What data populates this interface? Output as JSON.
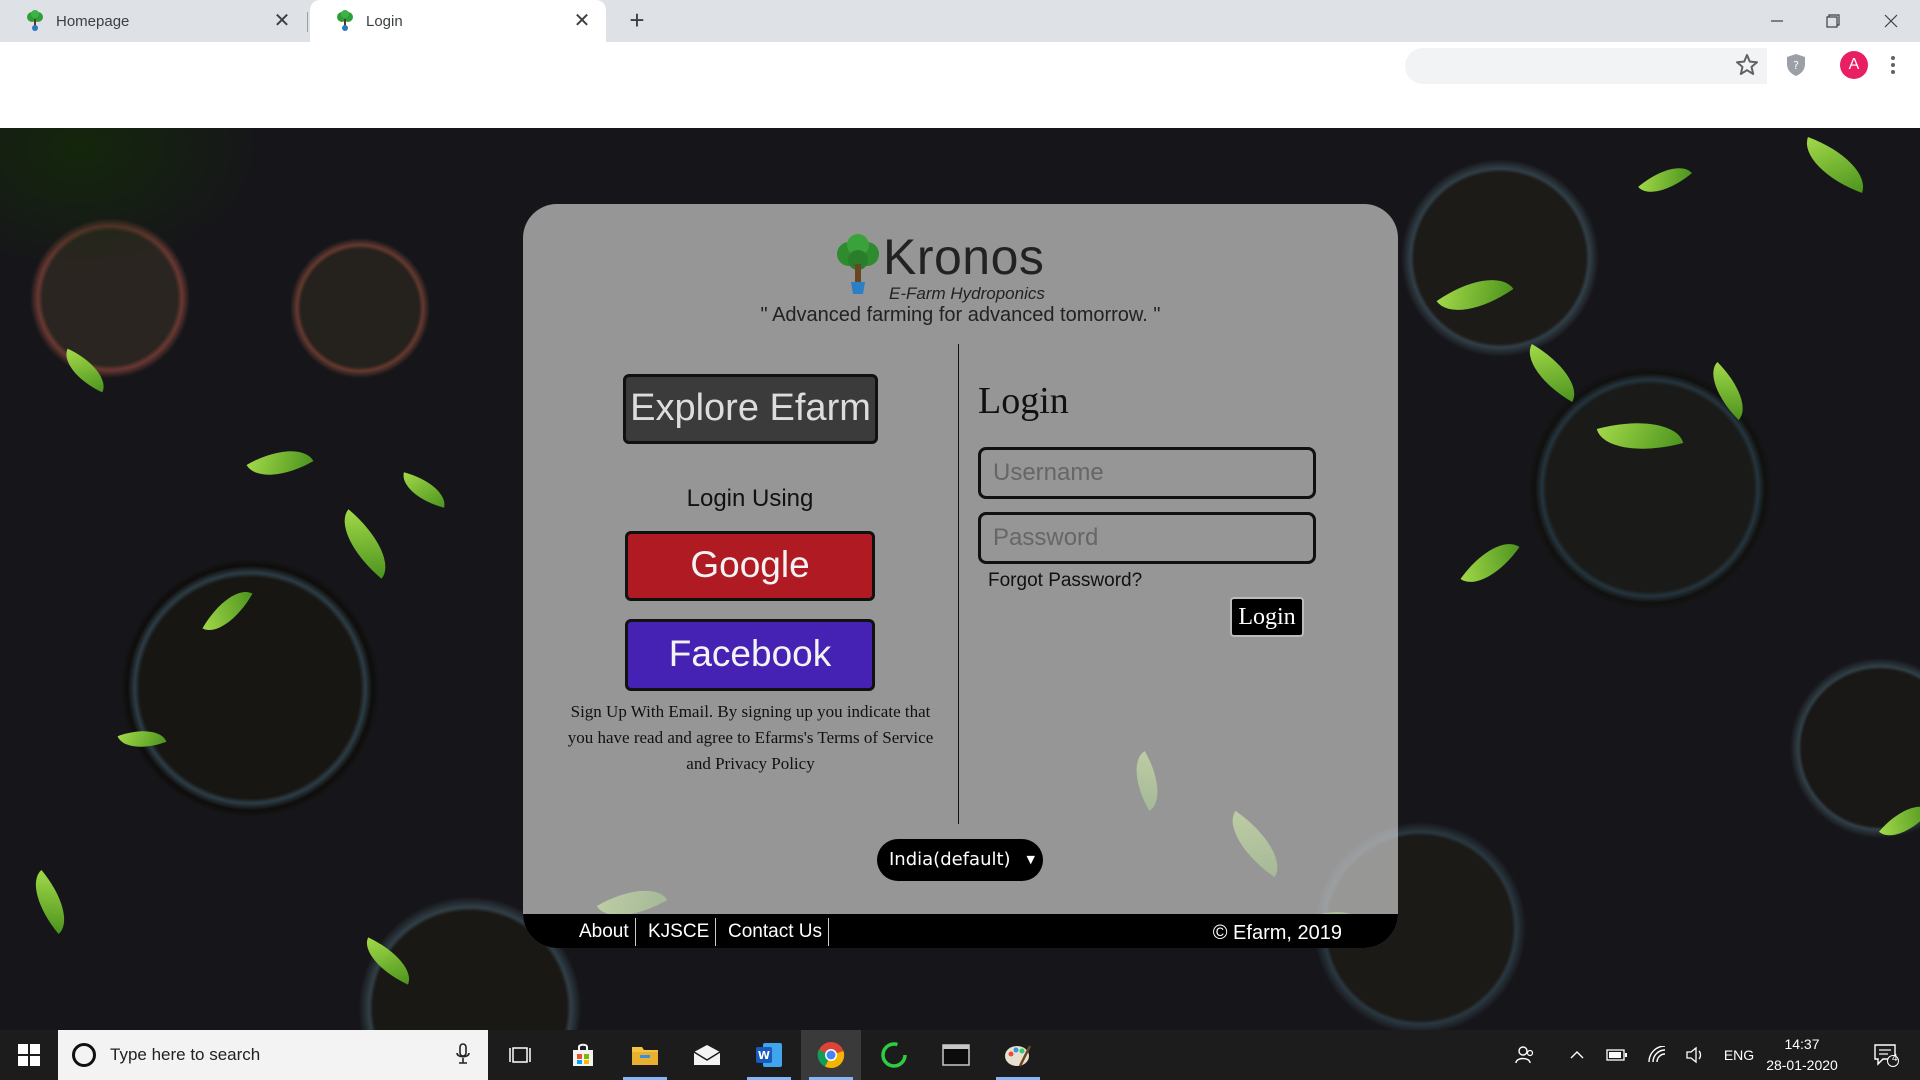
{
  "browser": {
    "tabs": [
      {
        "title": "Homepage",
        "active": false
      },
      {
        "title": "Login",
        "active": true
      }
    ],
    "new_tab": "+",
    "profile_initial": "A"
  },
  "page": {
    "brand": {
      "name": "Kronos",
      "subtitle": "E-Farm Hydroponics"
    },
    "tagline": "\" Advanced farming for advanced tomorrow. \"",
    "explore_button": "Explore Efarm",
    "login_using": "Login Using",
    "google_button": "Google",
    "facebook_button": "Facebook",
    "signup_text": "Sign Up With Email. By signing up you indicate that you have read and agree to Efarms's Terms of Service and Privacy Policy",
    "login": {
      "heading": "Login",
      "username_placeholder": "Username",
      "password_placeholder": "Password",
      "forgot_password": "Forgot Password?",
      "submit": "Login"
    },
    "region_select": "India(default)",
    "footer": {
      "links": [
        "About",
        "KJSCE",
        "Contact Us"
      ],
      "copyright": "© Efarm, 2019"
    },
    "colors": {
      "google": "#b01a22",
      "facebook": "#4522b4",
      "explore": "#3c3b3b"
    }
  },
  "taskbar": {
    "search_placeholder": "Type here to search",
    "language": "ENG",
    "time": "14:37",
    "date": "28-01-2020",
    "notification_count": "4"
  }
}
